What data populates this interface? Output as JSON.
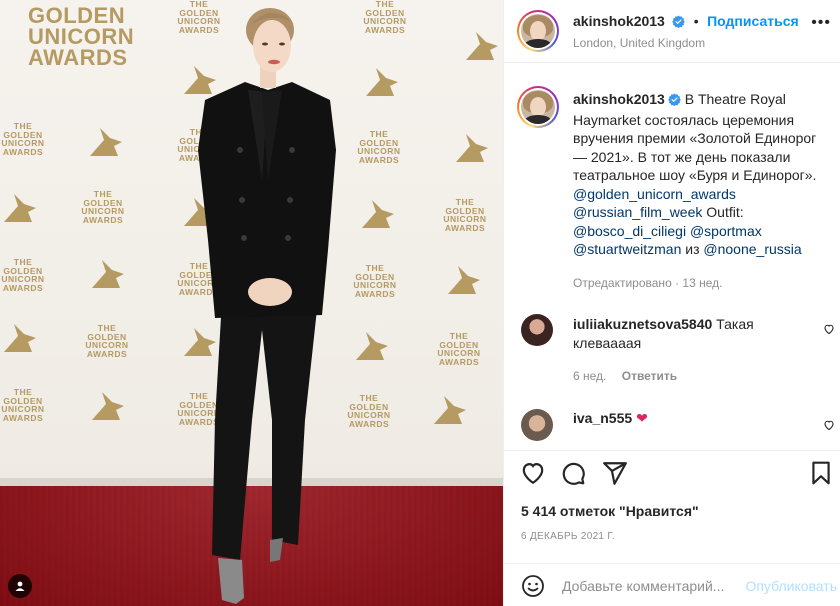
{
  "post": {
    "username": "akinshok2013",
    "follow_label": "Подписаться",
    "separator": "•",
    "location": "London, United Kingdom",
    "more_label": "•••"
  },
  "photo": {
    "big_logo": [
      "GOLDEN",
      "UNICORN",
      "AWARDS"
    ],
    "small_logo": [
      "THE",
      "GOLDEN",
      "UNICORN",
      "AWARDS"
    ]
  },
  "caption": {
    "username": "akinshok2013",
    "text_1": " В Theatre Royal Haymarket состоялась церемония вручения премии «Золотой Единорог — 2021». В тот же день показали театральное шоу «Буря и Единорог». ",
    "mention_1": "@golden_unicorn_awards",
    "mention_2": "@russian_film_week",
    "text_2": " Outfit: ",
    "mention_3": "@bosco_di_ciliegi",
    "mention_4": "@sportmax",
    "mention_5": "@stuartweitzman",
    "text_3": " из ",
    "mention_6": "@noone_russia",
    "edited": "Отредактировано",
    "edited_sep": " · ",
    "edited_time": "13 нед."
  },
  "comments": [
    {
      "username": "iuliiakuznetsova5840",
      "text": " Такая клеваааая",
      "time": "6 нед.",
      "reply_label": "Ответить"
    },
    {
      "username": "iva_n555",
      "text": " ",
      "emoji": "❤"
    }
  ],
  "actions": {
    "likes_count": "5 414 отметок \"Нравится\"",
    "date": "6 ДЕКАБРЬ 2021 Г.",
    "icons": [
      "heart-icon",
      "comment-icon",
      "share-icon",
      "bookmark-icon"
    ]
  },
  "add_comment": {
    "placeholder": "Добавьте комментарий...",
    "publish_label": "Опубликовать"
  },
  "colors": {
    "link": "#00376b",
    "follow": "#0095f6",
    "publish_disabled": "#b2dffc",
    "carpet": "#930f17",
    "gold": "#b59a62"
  }
}
